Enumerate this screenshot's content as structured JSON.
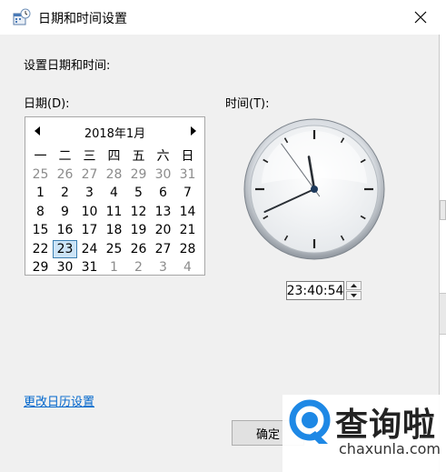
{
  "window": {
    "title": "日期和时间设置",
    "close_symbol": "✕"
  },
  "main": {
    "heading": "设置日期和时间:",
    "date_label": "日期(D):",
    "time_label": "时间(T):"
  },
  "calendar": {
    "prev_symbol": "◀",
    "next_symbol": "▶",
    "month_title": "2018年1月",
    "weekdays": [
      "一",
      "二",
      "三",
      "四",
      "五",
      "六",
      "日"
    ],
    "rows": [
      [
        "25",
        "26",
        "27",
        "28",
        "29",
        "30",
        "31"
      ],
      [
        "1",
        "2",
        "3",
        "4",
        "5",
        "6",
        "7"
      ],
      [
        "8",
        "9",
        "10",
        "11",
        "12",
        "13",
        "14"
      ],
      [
        "15",
        "16",
        "17",
        "18",
        "19",
        "20",
        "21"
      ],
      [
        "22",
        "23",
        "24",
        "25",
        "26",
        "27",
        "28"
      ],
      [
        "29",
        "30",
        "31",
        "1",
        "2",
        "3",
        "4"
      ]
    ],
    "selected_day": "23"
  },
  "clock": {
    "hour": 23,
    "minute": 40,
    "second": 54
  },
  "time": {
    "value": "23:40:54",
    "up_symbol": "▲",
    "down_symbol": "▼"
  },
  "footer": {
    "calendar_settings_link": "更改日历设置",
    "ok_button": "确定"
  },
  "watermark": {
    "title": "查询啦",
    "subtitle": "chaxunla.com"
  },
  "colors": {
    "link": "#0066cc",
    "selected_bg": "#cce4f7",
    "selected_border": "#3c7fb1",
    "watermark_blue": "#1e88e5"
  }
}
